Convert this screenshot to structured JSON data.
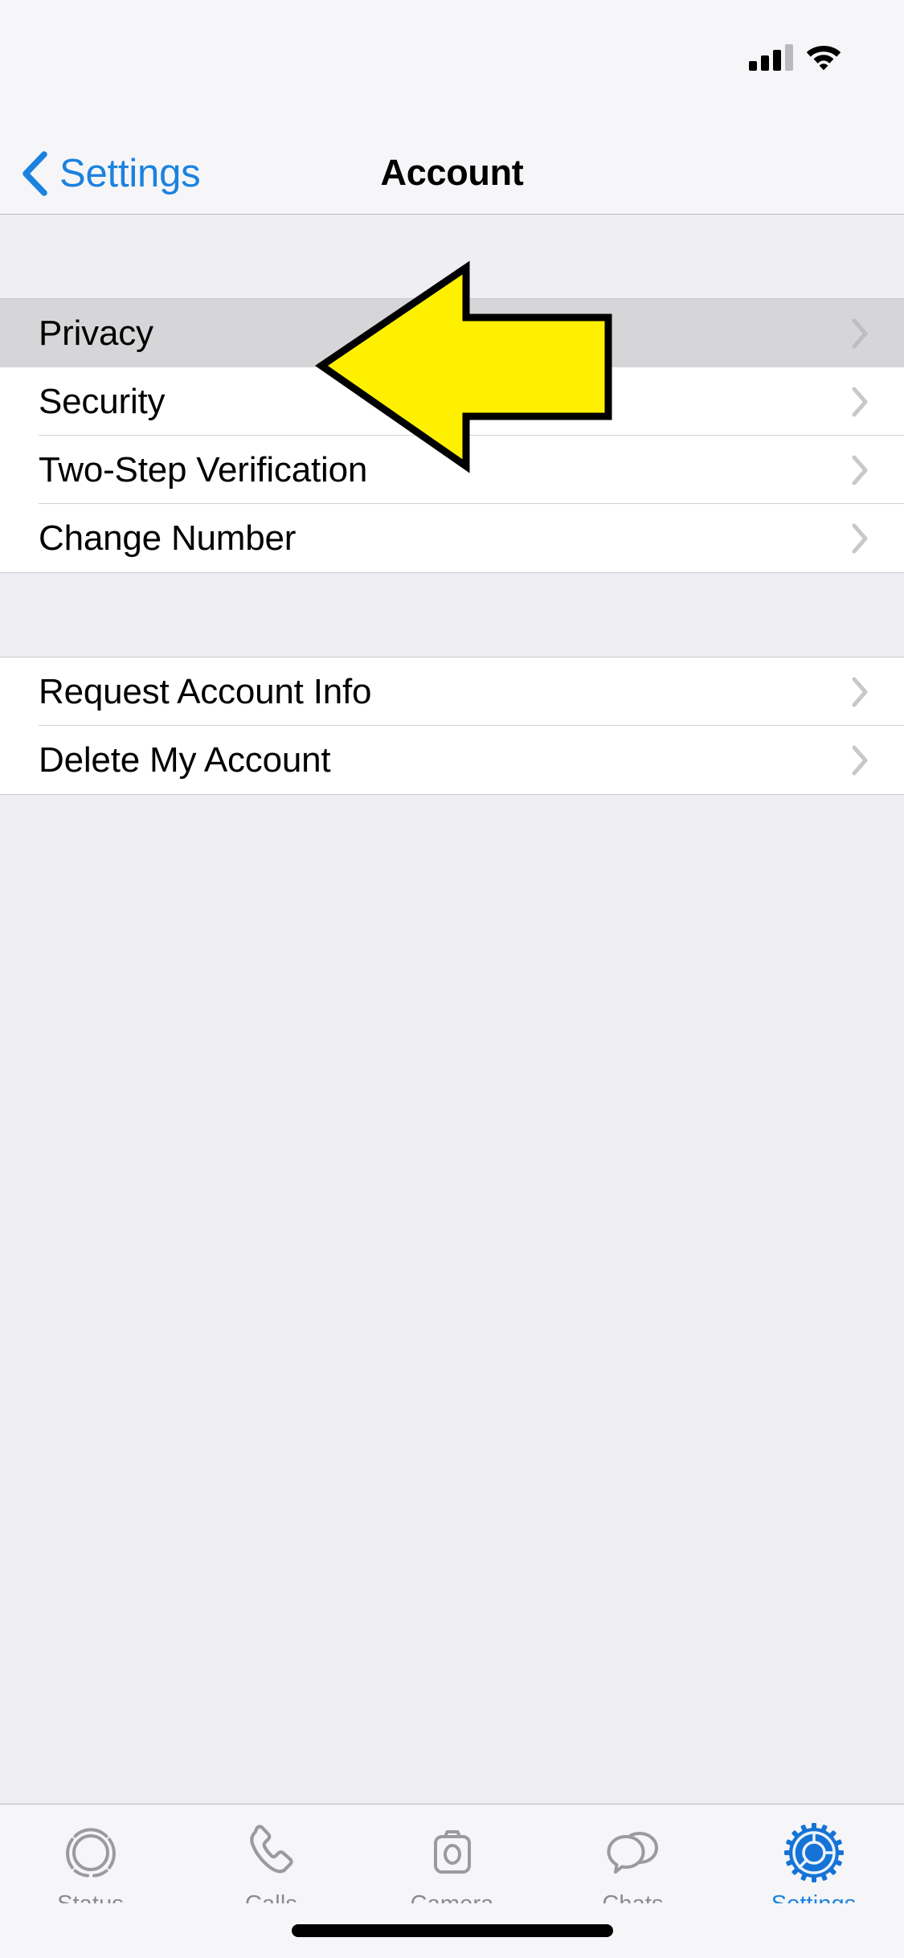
{
  "status_bar": {
    "signal_icon": "cellular-signal-icon",
    "signal_bars_filled": 3,
    "signal_bars_total": 4,
    "wifi_icon": "wifi-icon"
  },
  "nav": {
    "back_label": "Settings",
    "back_icon": "chevron-left-icon",
    "title": "Account"
  },
  "sections": [
    {
      "rows": [
        {
          "label": "Privacy",
          "selected": true,
          "accessory": "chevron-right-icon"
        },
        {
          "label": "Security",
          "selected": false,
          "accessory": "chevron-right-icon"
        },
        {
          "label": "Two-Step Verification",
          "selected": false,
          "accessory": "chevron-right-icon"
        },
        {
          "label": "Change Number",
          "selected": false,
          "accessory": "chevron-right-icon"
        }
      ]
    },
    {
      "rows": [
        {
          "label": "Request Account Info",
          "selected": false,
          "accessory": "chevron-right-icon"
        },
        {
          "label": "Delete My Account",
          "selected": false,
          "accessory": "chevron-right-icon"
        }
      ]
    }
  ],
  "annotation": {
    "type": "arrow",
    "direction": "left",
    "fill_color": "#FFF000",
    "stroke_color": "#000000",
    "points_at": "Privacy"
  },
  "tab_bar": {
    "items": [
      {
        "label": "Status",
        "icon": "status-ring-icon",
        "active": false
      },
      {
        "label": "Calls",
        "icon": "phone-icon",
        "active": false
      },
      {
        "label": "Camera",
        "icon": "camera-icon",
        "active": false
      },
      {
        "label": "Chats",
        "icon": "chat-bubbles-icon",
        "active": false
      },
      {
        "label": "Settings",
        "icon": "gear-icon",
        "active": true
      }
    ]
  },
  "colors": {
    "accent": "#1c82df",
    "inactive": "#8a8a8f",
    "selected_row": "#d6d6d8",
    "background": "#eeeef3",
    "chrome": "#f6f6f8",
    "chevron": "#c7c7cc"
  }
}
